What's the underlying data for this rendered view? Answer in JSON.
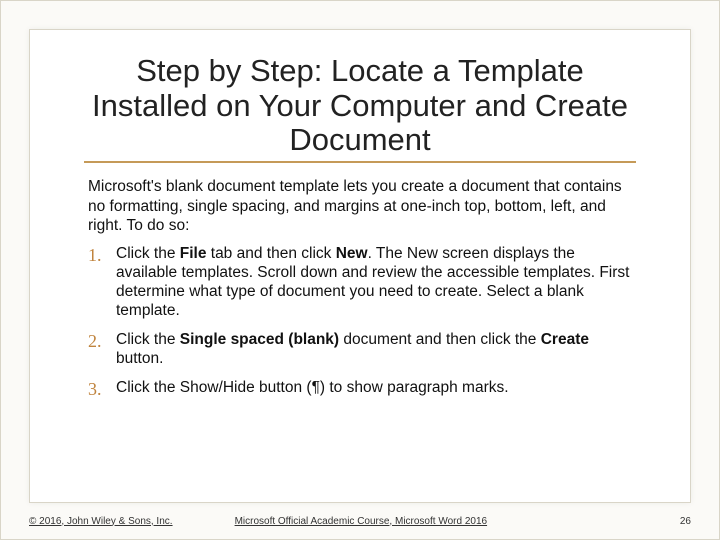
{
  "title": "Step by Step: Locate a Template Installed on Your Computer and Create Document",
  "intro": "Microsoft's blank document template lets you create a document that contains no formatting, single spacing, and margins at one-inch top, bottom, left, and right. To do so:",
  "steps": [
    {
      "num": "1.",
      "html": "Click the <b>File</b> tab and then click <b>New</b>. The New screen displays the available templates. Scroll down and review the accessible templates. First determine what type of document you need to create. Select a blank template."
    },
    {
      "num": "2.",
      "html": "Click the <b>Single spaced (blank)</b> document and then click the <b>Create</b> button."
    },
    {
      "num": "3.",
      "html": "Click the Show/Hide button (¶) to show paragraph marks."
    }
  ],
  "footer": {
    "copyright": "© 2016, John Wiley & Sons, Inc.",
    "course": "Microsoft Official Academic Course, Microsoft Word 2016",
    "page": "26"
  }
}
